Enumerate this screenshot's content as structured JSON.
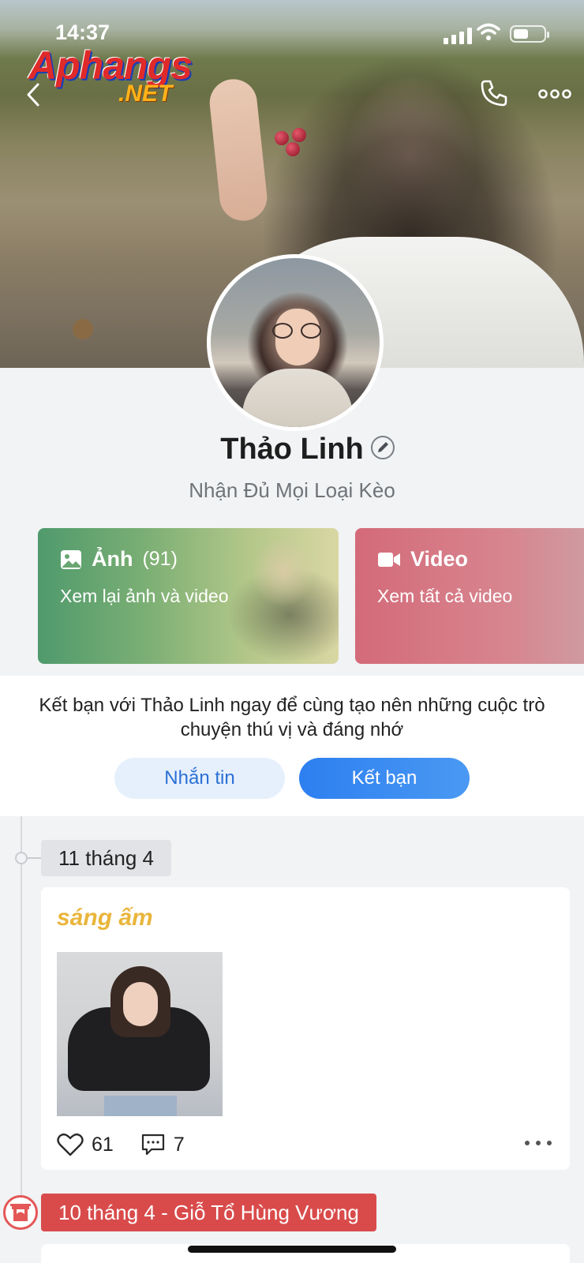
{
  "status_bar": {
    "time": "14:37"
  },
  "watermark": {
    "line1": "Aphangs",
    "line2": ".NET"
  },
  "header": {
    "back_icon": "chevron-left-icon",
    "call_icon": "phone-icon",
    "more_icon": "ellipsis-icon"
  },
  "profile": {
    "name": "Thảo Linh",
    "bio": "Nhận Đủ Mọi Loại Kèo"
  },
  "media": {
    "photos": {
      "label": "Ảnh",
      "count": "(91)",
      "subtitle": "Xem lại ảnh và video",
      "icon": "image-icon"
    },
    "videos": {
      "label": "Video",
      "subtitle": "Xem tất cả video",
      "icon": "video-camera-icon"
    }
  },
  "friend": {
    "message": "Kết bạn với Thảo Linh ngay để cùng tạo nên những cuộc trò chuyện thú vị và đáng nhớ",
    "message_button": "Nhắn tin",
    "add_button": "Kết bạn"
  },
  "timeline": {
    "date1": "11 tháng 4",
    "post": {
      "title": "sáng ấm",
      "likes": "61",
      "comments": "7"
    },
    "date2": "10 tháng 4 - Giỗ Tổ Hùng Vương"
  },
  "colors": {
    "accent_blue": "#2d7ff0",
    "post_title": "#e9b53b",
    "holiday_red": "#d94b4b",
    "photo_card": "#4f9a6c",
    "video_card": "#d46a79"
  }
}
